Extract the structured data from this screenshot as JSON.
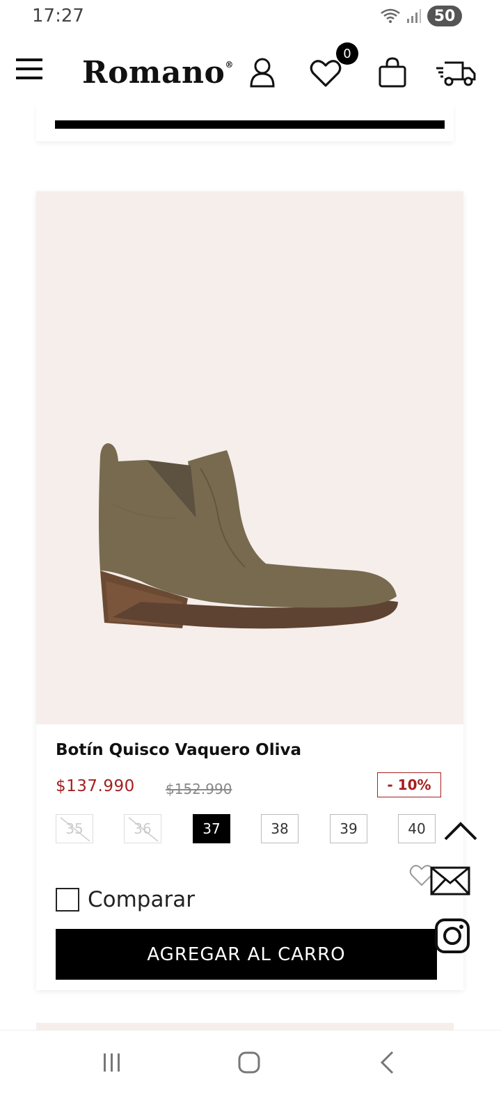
{
  "status_bar": {
    "time": "17:27",
    "battery": "50"
  },
  "header": {
    "brand": "Romano",
    "wishlist_count": "0"
  },
  "product": {
    "title": "Botín Quisco Vaquero Oliva",
    "price": "$137.990",
    "old_price": "$152.990",
    "discount": "- 10%",
    "sizes": [
      {
        "label": "35",
        "state": "unavailable"
      },
      {
        "label": "36",
        "state": "unavailable"
      },
      {
        "label": "37",
        "state": "selected"
      },
      {
        "label": "38",
        "state": "available"
      },
      {
        "label": "39",
        "state": "available"
      },
      {
        "label": "40",
        "state": "available"
      }
    ],
    "compare_label": "Comparar",
    "add_to_cart_label": "AGREGAR AL CARRO"
  },
  "colors": {
    "accent_price": "#a3201f",
    "image_background": "#f5eeeb",
    "button": "#000000"
  },
  "icons": [
    "menu-icon",
    "user-icon",
    "heart-icon",
    "bag-icon",
    "truck-icon",
    "chevron-up-icon",
    "mail-icon",
    "instagram-icon",
    "recent-apps-icon",
    "home-icon",
    "back-icon"
  ]
}
